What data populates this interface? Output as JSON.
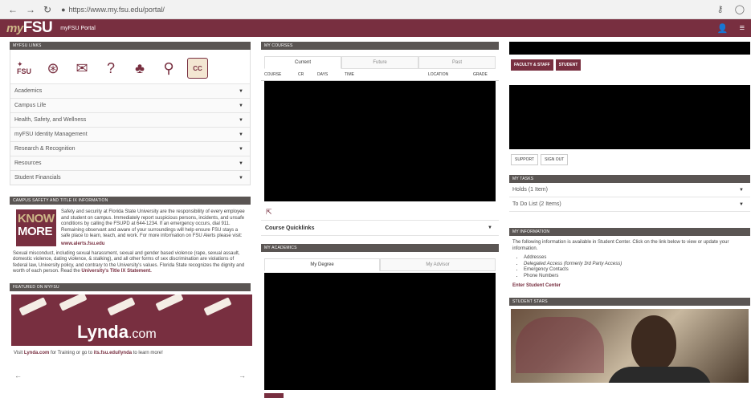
{
  "browser": {
    "url": "https://www.my.fsu.edu/portal/"
  },
  "app": {
    "logo_my": "my",
    "logo_fsu": "FSU",
    "portal_label": "myFSU Portal"
  },
  "links_panel": {
    "header": "MYFSU LINKS",
    "icons": [
      "fsu-icon",
      "lifesaver-icon",
      "email-icon",
      "help-icon",
      "sc-icon",
      "user-key-icon",
      "cc-icon"
    ],
    "items": [
      {
        "label": "Academics"
      },
      {
        "label": "Campus Life"
      },
      {
        "label": "Health, Safety, and Wellness"
      },
      {
        "label": "myFSU Identity Management"
      },
      {
        "label": "Research & Recognition"
      },
      {
        "label": "Resources"
      },
      {
        "label": "Student Financials"
      }
    ]
  },
  "safety_panel": {
    "header": "CAMPUS SAFETY AND TITLE IX INFORMATION",
    "badge_line1": "KNOW",
    "badge_line2": "MORE",
    "paragraph1": "Safety and security at Florida State University are the responsibility of every employee and student on campus. Immediately report suspicious persons, incidents, and unsafe conditions by calling the FSUPD at 644-1234. If an emergency occurs, dial 911. Remaining observant and aware of your surroundings will help ensure FSU stays a safe place to learn, teach, and work. For more information on FSU Alerts please visit:",
    "alerts_link": "www.alerts.fsu.edu",
    "paragraph2": "Sexual misconduct, including sexual harassment, sexual and gender based violence (rape, sexual assault, domestic violence, dating violence, & stalking), and all other forms of sex discrimination are violations of federal law, University policy, and contrary to the University's values. Florida State recognizes the dignity and worth of each person. Read the",
    "title_ix_link": "University's Title IX Statement."
  },
  "featured_panel": {
    "header": "FEATURED ON MYFSU",
    "brand_main": "Lynda",
    "brand_suffix": ".com",
    "visit_prefix": "Visit",
    "visit_lynda": "Lynda.com",
    "visit_middle": "for Training or go to",
    "visit_link": "its.fsu.edu/lynda",
    "visit_suffix": "to learn more!",
    "prev": "←",
    "next": "→"
  },
  "courses_panel": {
    "header": "MY COURSES",
    "tabs": [
      {
        "label": "Current"
      },
      {
        "label": "Future"
      },
      {
        "label": "Past"
      }
    ],
    "columns": [
      "COURSE",
      "CR",
      "DAYS",
      "TIME",
      "LOCATION",
      "GRADE"
    ],
    "quicklinks_label": "Course Quicklinks"
  },
  "academics_panel": {
    "header": "MY ACADEMICS",
    "tabs": [
      {
        "label": "My Degree"
      },
      {
        "label": "My Advisor"
      }
    ]
  },
  "account_panel": {
    "buttons": [
      {
        "label": "FACULTY & STAFF"
      },
      {
        "label": "STUDENT"
      }
    ],
    "support": "SUPPORT",
    "signout": "SIGN OUT"
  },
  "tasks_panel": {
    "header": "MY TASKS",
    "items": [
      {
        "label": "Holds (1 Item)"
      },
      {
        "label": "To Do List (2 Items)"
      }
    ]
  },
  "info_panel": {
    "header": "MY INFORMATION",
    "intro": "The following information is available in Student Center. Click on the link below to view or update your information.",
    "items": [
      {
        "label": "Addresses"
      },
      {
        "label": "Delegated Access (formerly 3rd Party Access)"
      },
      {
        "label": "Emergency Contacts"
      },
      {
        "label": "Phone Numbers"
      }
    ],
    "enter_link": "Enter Student Center"
  },
  "stars_panel": {
    "header": "STUDENT STARS"
  },
  "colors": {
    "garnet": "#782f40",
    "gold": "#ceb888",
    "panel_header": "#5a5553"
  }
}
